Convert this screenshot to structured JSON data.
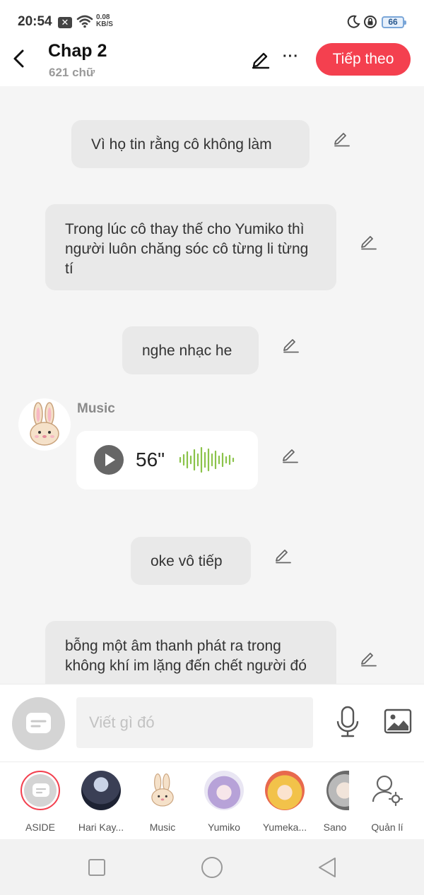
{
  "status_bar": {
    "time": "20:54",
    "notification_glyph": "✕",
    "net_speed_value": "0.08",
    "net_speed_unit": "KB/S",
    "battery": "66"
  },
  "header": {
    "title": "Chap 2",
    "word_count": "621 chữ",
    "more_glyph": "···",
    "next_label": "Tiếp theo"
  },
  "messages": [
    {
      "text": "Vì họ tin rằng cô không làm"
    },
    {
      "text": "Trong lúc cô thay thế cho Yumiko thì người luôn chăng sóc cô từng li từng tí"
    },
    {
      "text": "nghe nhạc he"
    },
    {
      "speaker": "Music",
      "duration": "56\""
    },
    {
      "text": "oke vô tiếp"
    },
    {
      "text": "bỗng một âm thanh phát ra trong không khí im lặng đến chết người đó"
    }
  ],
  "input": {
    "placeholder": "Viết gì đó"
  },
  "characters": [
    {
      "label": "ASIDE"
    },
    {
      "label": "Hari Kay..."
    },
    {
      "label": "Music"
    },
    {
      "label": "Yumiko"
    },
    {
      "label": "Yumeka..."
    },
    {
      "label": "Sano"
    },
    {
      "label": "Quản lí"
    }
  ],
  "colors": {
    "accent": "#f4404f",
    "waveform": "#8bc34a",
    "chat_bg": "#f5f5f5",
    "bubble": "#e9e9e9"
  }
}
